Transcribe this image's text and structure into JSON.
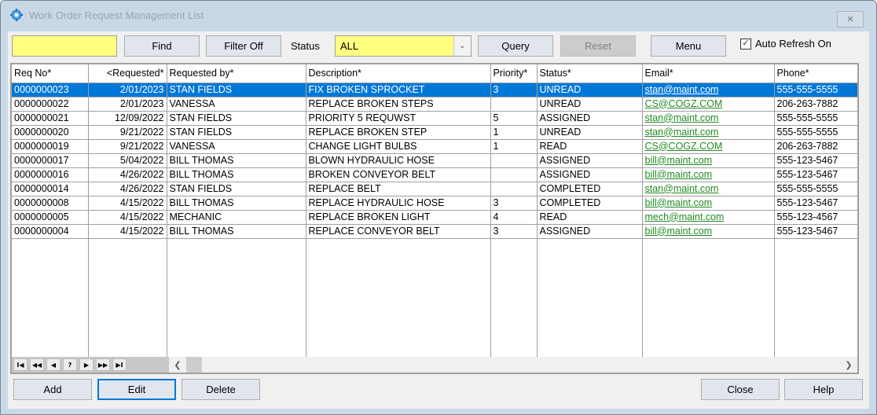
{
  "window": {
    "title": "Work Order Request Management List",
    "close_glyph": "✕"
  },
  "toolbar": {
    "find_value": "",
    "find_label": "Find",
    "filter_label": "Filter Off",
    "status_label": "Status",
    "status_value": "ALL",
    "query_label": "Query",
    "reset_label": "Reset",
    "menu_label": "Menu",
    "auto_refresh_label": "Auto Refresh On",
    "auto_refresh_checked": true
  },
  "grid": {
    "columns": [
      "Req No*",
      "<Requested*",
      "Requested by*",
      "Description*",
      "Priority*",
      "Status*",
      "Email*",
      "Phone*"
    ],
    "rows": [
      {
        "req_no": "0000000023",
        "requested": "2/01/2023",
        "requested_by": "STAN FIELDS",
        "description": "FIX BROKEN SPROCKET",
        "priority": "3",
        "status": "UNREAD",
        "email": "stan@maint.com",
        "phone": "555-555-5555",
        "selected": true
      },
      {
        "req_no": "0000000022",
        "requested": "2/01/2023",
        "requested_by": "VANESSA",
        "description": "REPLACE BROKEN STEPS",
        "priority": "",
        "status": "UNREAD",
        "email": "CS@COGZ.COM",
        "phone": "206-263-7882"
      },
      {
        "req_no": "0000000021",
        "requested": "12/09/2022",
        "requested_by": "STAN FIELDS",
        "description": "PRIORITY 5 REQUWST",
        "priority": "5",
        "status": "ASSIGNED",
        "email": "stan@maint.com",
        "phone": "555-555-5555"
      },
      {
        "req_no": "0000000020",
        "requested": "9/21/2022",
        "requested_by": "STAN FIELDS",
        "description": "REPLACE BROKEN STEP",
        "priority": "1",
        "status": "UNREAD",
        "email": "stan@maint.com",
        "phone": "555-555-5555"
      },
      {
        "req_no": "0000000019",
        "requested": "9/21/2022",
        "requested_by": "VANESSA",
        "description": "CHANGE LIGHT BULBS",
        "priority": "1",
        "status": "READ",
        "email": "CS@COGZ.COM",
        "phone": "206-263-7882"
      },
      {
        "req_no": "0000000017",
        "requested": "5/04/2022",
        "requested_by": "BILL THOMAS",
        "description": "BLOWN HYDRAULIC HOSE",
        "priority": "",
        "status": "ASSIGNED",
        "email": "bill@maint.com",
        "phone": "555-123-5467"
      },
      {
        "req_no": "0000000016",
        "requested": "4/26/2022",
        "requested_by": "BILL THOMAS",
        "description": "BROKEN CONVEYOR BELT",
        "priority": "",
        "status": "ASSIGNED",
        "email": "bill@maint.com",
        "phone": "555-123-5467"
      },
      {
        "req_no": "0000000014",
        "requested": "4/26/2022",
        "requested_by": "STAN FIELDS",
        "description": "REPLACE BELT",
        "priority": "",
        "status": "COMPLETED",
        "email": "stan@maint.com",
        "phone": "555-555-5555"
      },
      {
        "req_no": "0000000008",
        "requested": "4/15/2022",
        "requested_by": "BILL THOMAS",
        "description": "REPLACE HYDRAULIC HOSE",
        "priority": "3",
        "status": "COMPLETED",
        "email": "bill@maint.com",
        "phone": "555-123-5467"
      },
      {
        "req_no": "0000000005",
        "requested": "4/15/2022",
        "requested_by": "MECHANIC",
        "description": "REPLACE BROKEN LIGHT",
        "priority": "4",
        "status": "READ",
        "email": "mech@maint.com",
        "phone": "555-123-4567"
      },
      {
        "req_no": "0000000004",
        "requested": "4/15/2022",
        "requested_by": "BILL THOMAS",
        "description": "REPLACE CONVEYOR BELT",
        "priority": "3",
        "status": "ASSIGNED",
        "email": "bill@maint.com",
        "phone": "555-123-5467"
      }
    ]
  },
  "navigator": {
    "buttons": [
      {
        "name": "first-record",
        "glyph": "I◀"
      },
      {
        "name": "prev-page",
        "glyph": "◀◀"
      },
      {
        "name": "prev-record",
        "glyph": "◀"
      },
      {
        "name": "query",
        "glyph": "?"
      },
      {
        "name": "next-record",
        "glyph": "▶"
      },
      {
        "name": "next-page",
        "glyph": "▶▶"
      },
      {
        "name": "last-record",
        "glyph": "▶I"
      }
    ]
  },
  "footer": {
    "add_label": "Add",
    "edit_label": "Edit",
    "delete_label": "Delete",
    "close_label": "Close",
    "help_label": "Help"
  },
  "colors": {
    "highlight": "#ffff80",
    "selection": "#0078d7",
    "email_link": "#228b22"
  }
}
